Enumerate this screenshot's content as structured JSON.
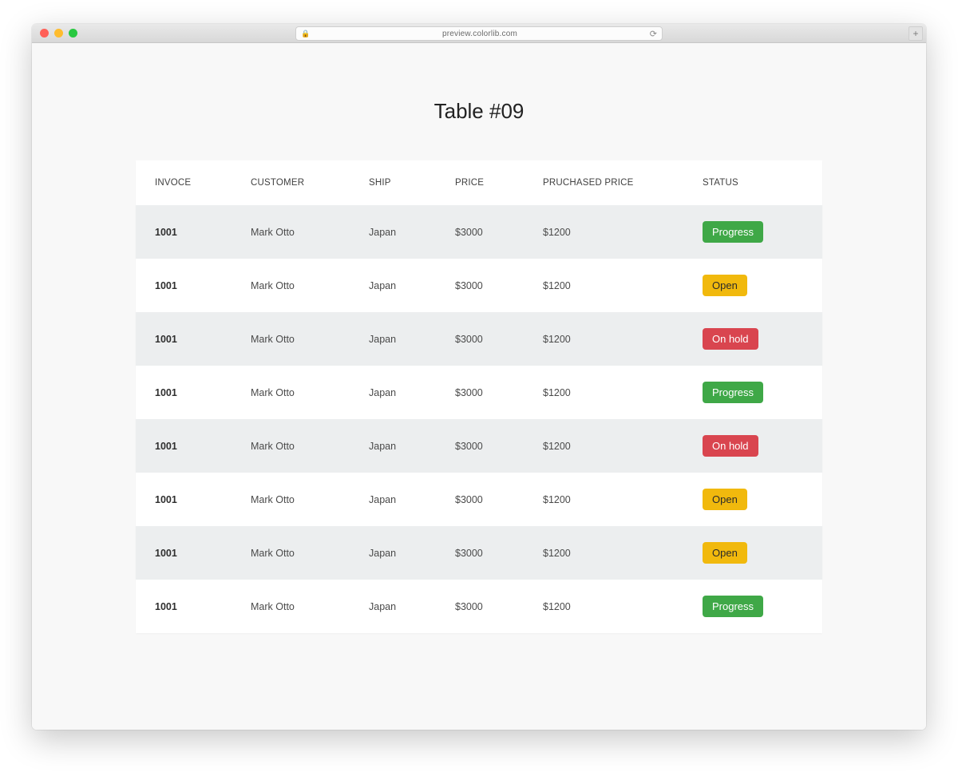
{
  "browser": {
    "url": "preview.colorlib.com"
  },
  "page": {
    "title": "Table #09"
  },
  "table": {
    "headers": [
      "INVOCE",
      "CUSTOMER",
      "SHIP",
      "PRICE",
      "PRUCHASED PRICE",
      "STATUS"
    ],
    "rows": [
      {
        "invoice": "1001",
        "customer": "Mark Otto",
        "ship": "Japan",
        "price": "$3000",
        "purchased": "$1200",
        "status": "Progress",
        "status_kind": "progress"
      },
      {
        "invoice": "1001",
        "customer": "Mark Otto",
        "ship": "Japan",
        "price": "$3000",
        "purchased": "$1200",
        "status": "Open",
        "status_kind": "open"
      },
      {
        "invoice": "1001",
        "customer": "Mark Otto",
        "ship": "Japan",
        "price": "$3000",
        "purchased": "$1200",
        "status": "On hold",
        "status_kind": "onhold"
      },
      {
        "invoice": "1001",
        "customer": "Mark Otto",
        "ship": "Japan",
        "price": "$3000",
        "purchased": "$1200",
        "status": "Progress",
        "status_kind": "progress"
      },
      {
        "invoice": "1001",
        "customer": "Mark Otto",
        "ship": "Japan",
        "price": "$3000",
        "purchased": "$1200",
        "status": "On hold",
        "status_kind": "onhold"
      },
      {
        "invoice": "1001",
        "customer": "Mark Otto",
        "ship": "Japan",
        "price": "$3000",
        "purchased": "$1200",
        "status": "Open",
        "status_kind": "open"
      },
      {
        "invoice": "1001",
        "customer": "Mark Otto",
        "ship": "Japan",
        "price": "$3000",
        "purchased": "$1200",
        "status": "Open",
        "status_kind": "open"
      },
      {
        "invoice": "1001",
        "customer": "Mark Otto",
        "ship": "Japan",
        "price": "$3000",
        "purchased": "$1200",
        "status": "Progress",
        "status_kind": "progress"
      }
    ]
  },
  "colors": {
    "progress": "#3fa847",
    "open": "#f1b90d",
    "onhold": "#d9454f"
  }
}
